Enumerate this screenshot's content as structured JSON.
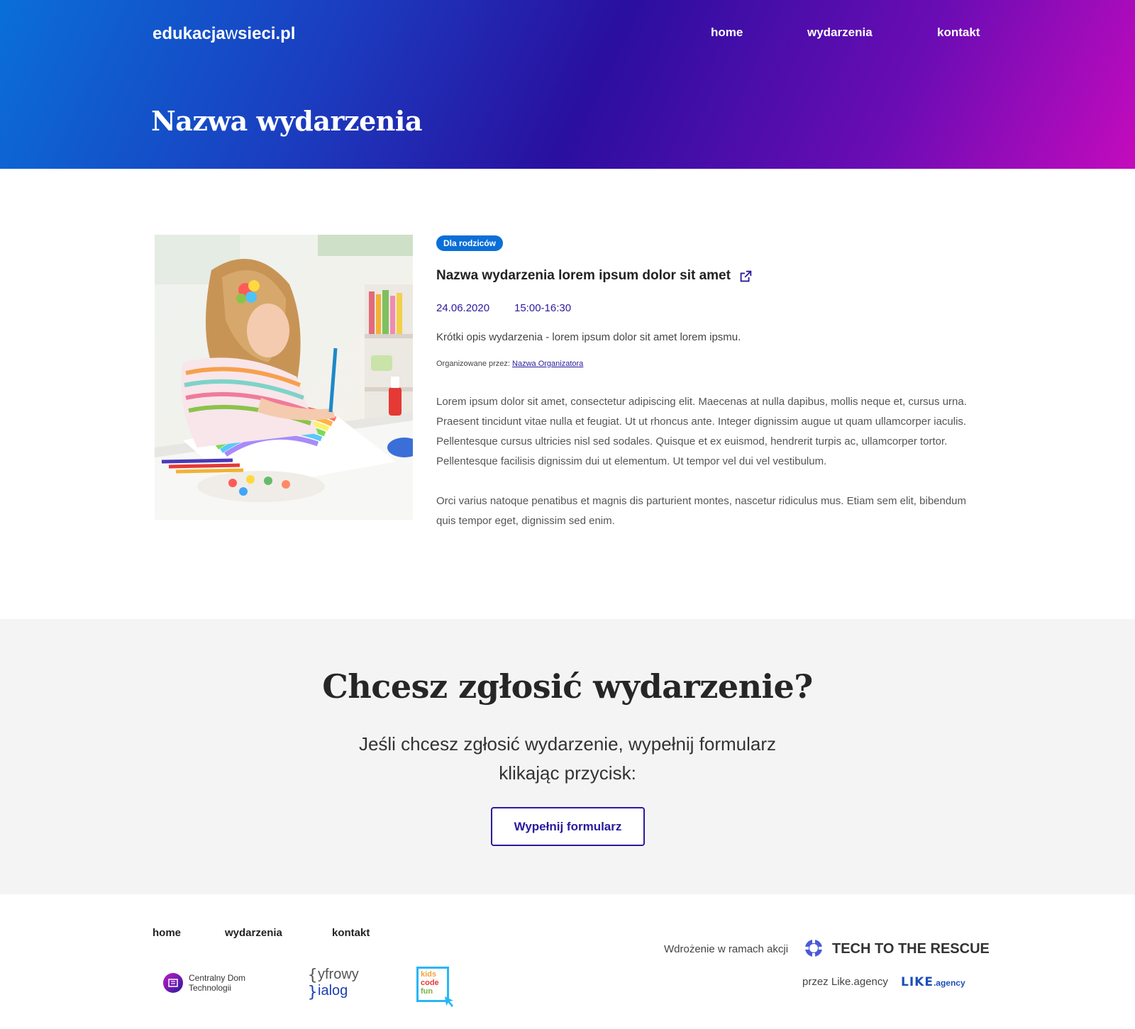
{
  "header": {
    "logo": {
      "part1": "edukacja",
      "part2": "w",
      "part3": "sieci.pl"
    },
    "nav": [
      "home",
      "wydarzenia",
      "kontakt"
    ],
    "page_title": "Nazwa wydarzenia"
  },
  "event": {
    "tag": "Dla rodziców",
    "title": "Nazwa wydarzenia lorem ipsum dolor sit amet",
    "date": "24.06.2020",
    "time": "15:00-16:30",
    "short_description": "Krótki opis wydarzenia - lorem ipsum dolor sit amet lorem ipsmu.",
    "organizer_label": "Organizowane przez:",
    "organizer_name": "Nazwa Organizatora",
    "paragraphs": [
      "Lorem ipsum dolor sit amet, consectetur adipiscing elit. Maecenas at nulla dapibus, mollis neque et, cursus urna. Praesent tincidunt vitae nulla et feugiat. Ut ut rhoncus ante. Integer dignissim augue ut quam ullamcorper iaculis. Pellentesque cursus ultricies nisl sed sodales. Quisque et ex euismod, hendrerit turpis ac, ullamcorper tortor. Pellentesque facilisis dignissim dui ut elementum. Ut tempor vel dui vel vestibulum.",
      "Orci varius natoque penatibus et magnis dis parturient montes, nascetur ridiculus mus. Etiam sem elit, bibendum quis tempor eget, dignissim sed enim."
    ]
  },
  "cta": {
    "title": "Chcesz zgłosić wydarzenie?",
    "text": "Jeśli chcesz zgłosić wydarzenie, wypełnij formularz klikając przycisk:",
    "button": "Wypełnij formularz"
  },
  "footer": {
    "nav": [
      "home",
      "wydarzenia",
      "kontakt"
    ],
    "partners": {
      "cdt": [
        "Centralny Dom",
        "Technologii"
      ],
      "cyfrowy": [
        "yfrowy",
        "ialog"
      ],
      "kcf": [
        "kids",
        "code",
        "fun"
      ]
    },
    "implementation_label": "Wdrożenie w ramach akcji",
    "campaign": "TECH TO THE RESCUE",
    "via_label": "przez Like.agency",
    "agency_logo": {
      "word": "LIKE",
      "suffix": ".agency"
    }
  },
  "colors": {
    "accent": "#2a1a9e",
    "tag": "#0b6fd8",
    "cta_bg": "#f4f4f4"
  },
  "icons": [
    "external-link-icon",
    "lifebuoy-icon"
  ]
}
